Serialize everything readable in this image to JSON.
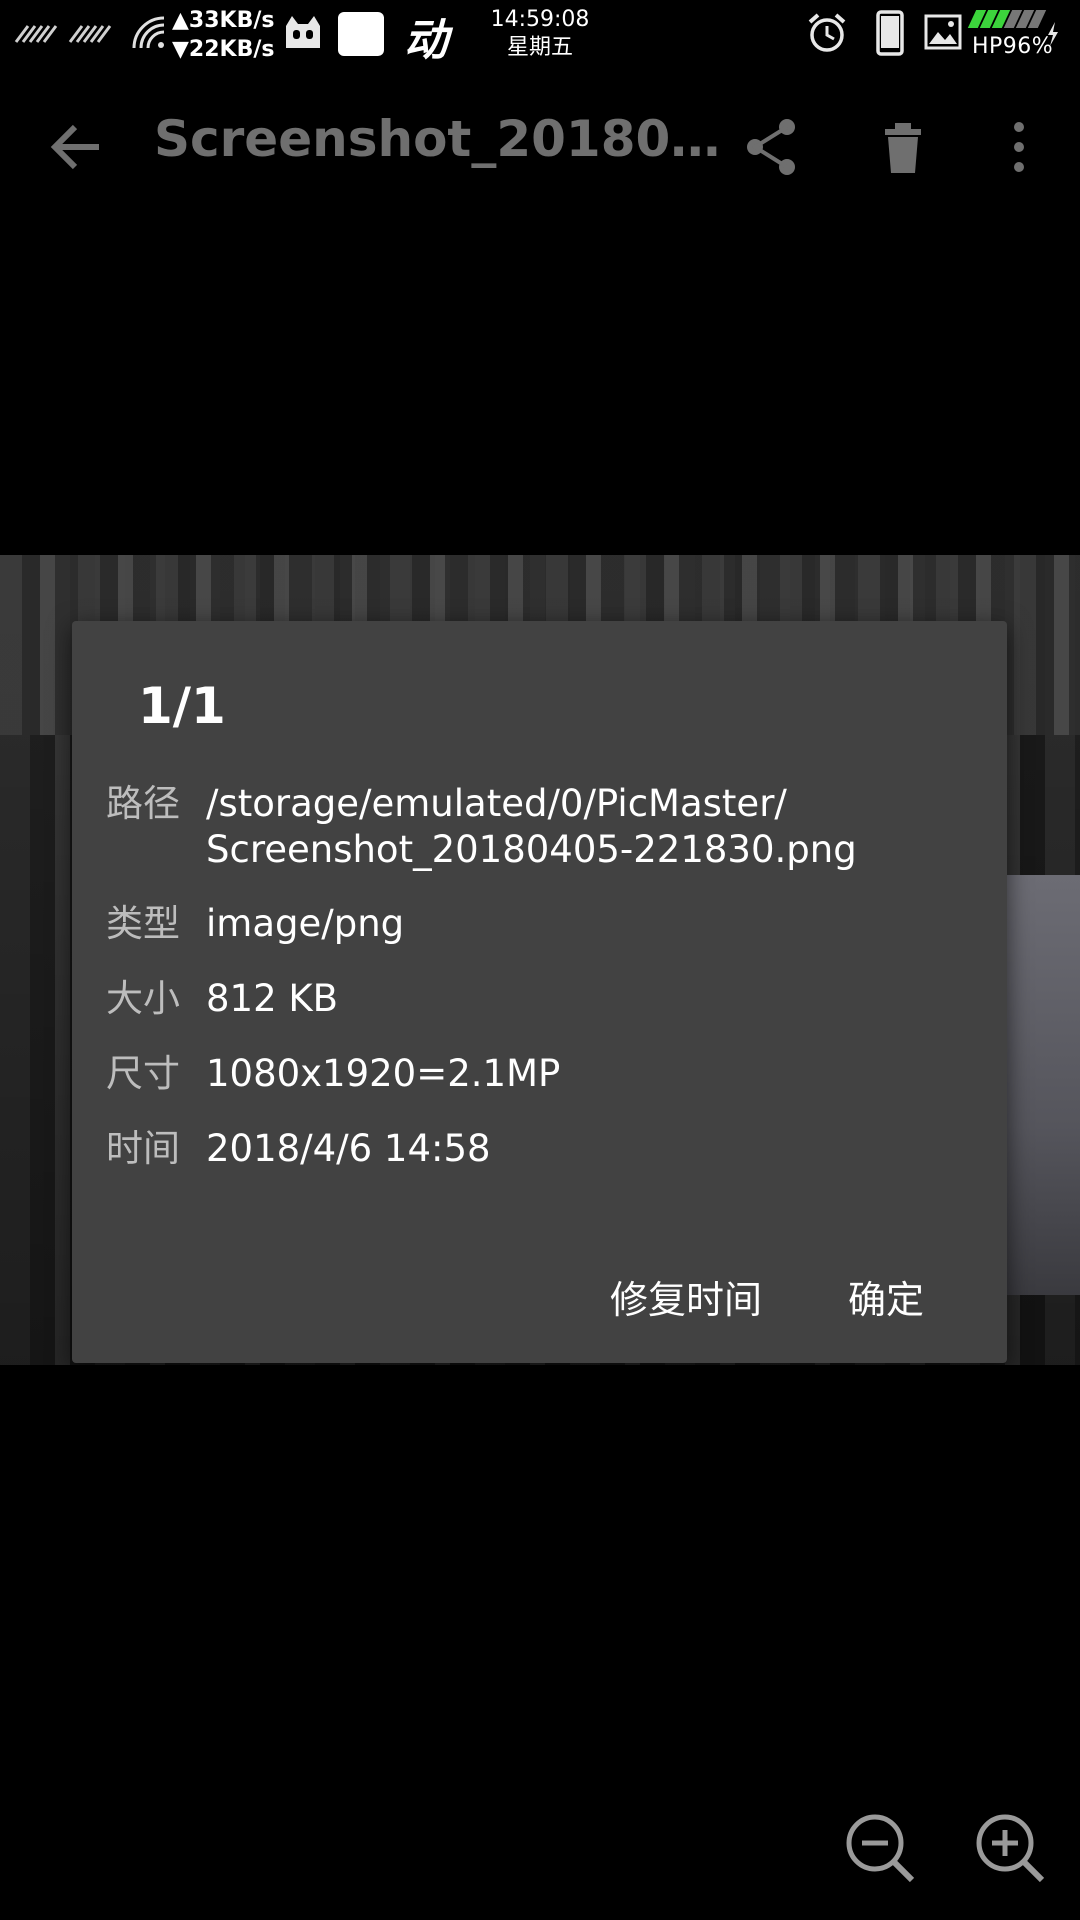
{
  "status_bar": {
    "upload_speed": "▲33KB/s",
    "download_speed": "▼22KB/s",
    "app_glyph": "动",
    "time": "14:59:08",
    "weekday": "星期五",
    "battery": "HP96%",
    "icons": [
      "signal-icon",
      "wifi-icon",
      "ghost-icon",
      "notification-icon",
      "alarm-icon",
      "phone-icon",
      "image-icon",
      "battery-icon",
      "charging-icon"
    ],
    "battery_color": "#3cd43c"
  },
  "toolbar": {
    "title": "Screenshot_20180…",
    "icons": [
      "back-arrow-icon",
      "share-icon",
      "delete-icon",
      "more-vert-icon"
    ]
  },
  "dialog": {
    "title": "1/1",
    "rows": [
      {
        "label": "路径",
        "value_line1": "/storage/emulated/0/PicMaster/",
        "value_line2": "Screenshot_20180405-221830.png"
      },
      {
        "label": "类型",
        "value": "image/png"
      },
      {
        "label": "大小",
        "value": "812 KB"
      },
      {
        "label": "尺寸",
        "value": "1080x1920=2.1MP"
      },
      {
        "label": "时间",
        "value": "2018/4/6 14:58"
      }
    ],
    "buttons": {
      "fix_time": "修复时间",
      "ok": "确定"
    }
  },
  "zoom": {
    "icons": [
      "zoom-out-icon",
      "zoom-in-icon"
    ]
  }
}
